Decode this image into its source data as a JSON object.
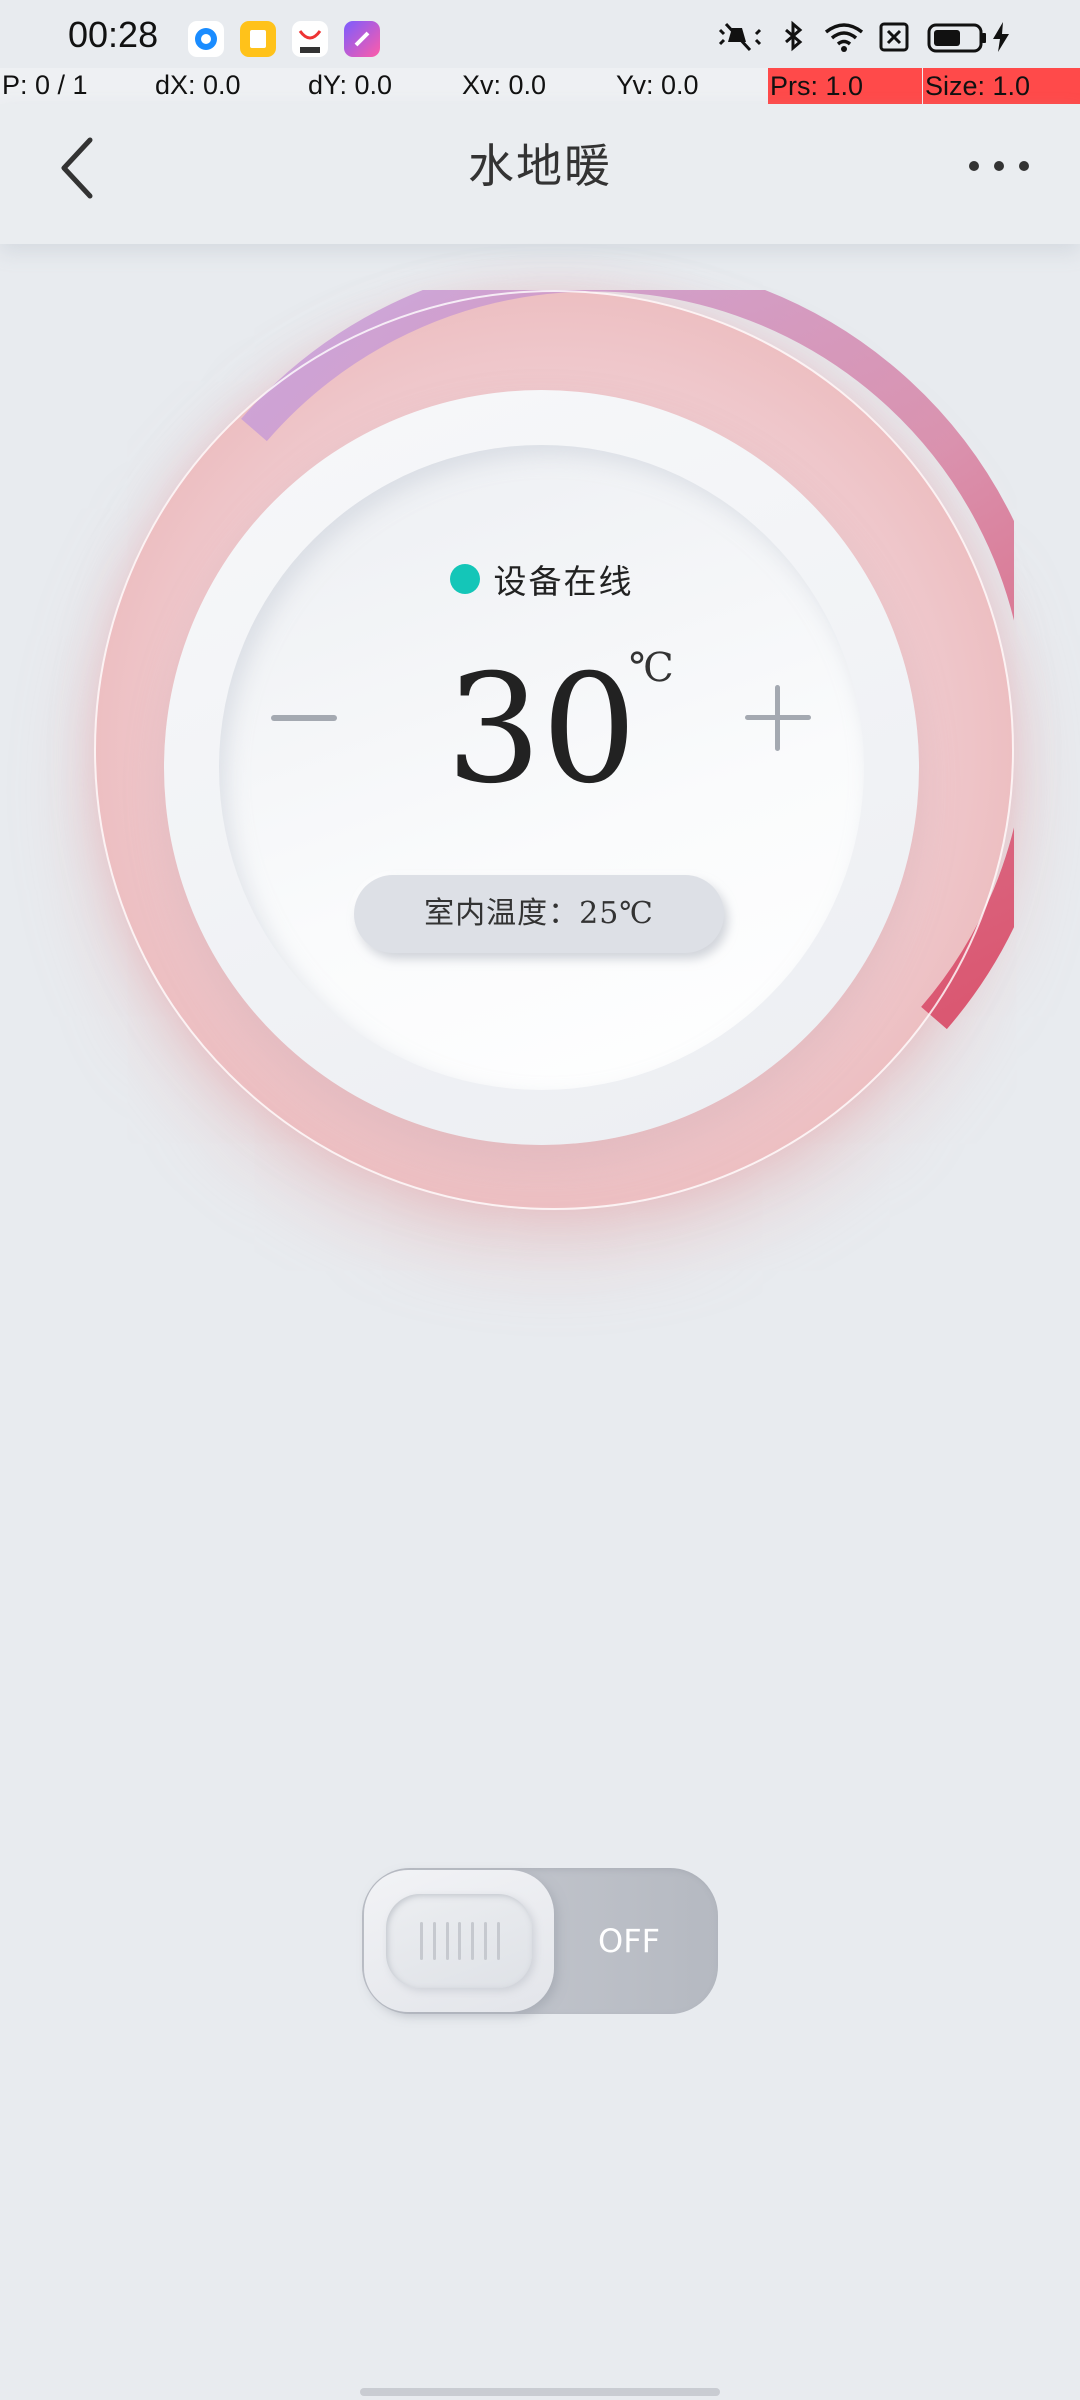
{
  "status_bar": {
    "time": "00:28"
  },
  "debug_bar": {
    "pointer": "P: 0 / 1",
    "dx": "dX: 0.0",
    "dy": "dY: 0.0",
    "xv": "Xv: 0.0",
    "yv": "Yv: 0.0",
    "prs": "Prs: 1.0",
    "size": "Size: 1.0"
  },
  "header": {
    "title": "水地暖"
  },
  "thermostat": {
    "status_text": "设备在线",
    "status_color": "#14c6b8",
    "set_temperature": "30",
    "unit": "℃",
    "room_temperature_label": "室内温度：",
    "room_temperature_value": "25℃"
  },
  "power_switch": {
    "state_label": "OFF"
  },
  "colors": {
    "background": "#e8ebef",
    "ring_start": "#c8a4e0",
    "ring_end": "#d9405c"
  }
}
